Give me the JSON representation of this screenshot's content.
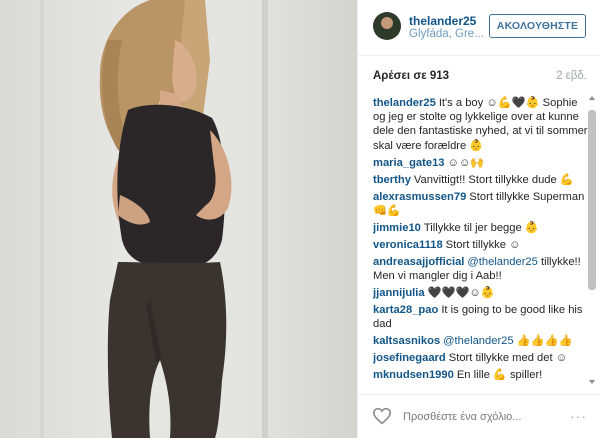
{
  "post": {
    "username": "thelander25",
    "location": "Glyfáda, Gre...",
    "follow_label": "ΑΚΟΛΟΥΘΗΣΤΕ",
    "likes": "Αρέσει σε 913",
    "time": "2 εβδ."
  },
  "comments": [
    {
      "user": "thelander25",
      "text": "It's a boy ☺💪🖤👶 Sophie og jeg er stolte og lykkelige over at kunne dele den fantastiske nyhed, at vi til sommer skal være forældre 👶"
    },
    {
      "user": "maria_gate13",
      "text": "☺☺🙌"
    },
    {
      "user": "tberthy",
      "text": "Vanvittigt!! Stort tillykke dude 💪"
    },
    {
      "user": "alexrasmussen79",
      "text": "Stort tillykke Superman 👊💪"
    },
    {
      "user": "jimmie10",
      "text": "Tillykke til jer begge 👶"
    },
    {
      "user": "veronica1118",
      "text": "Stort tillykke ☺"
    },
    {
      "user": "andreasajjofficial",
      "mention": "@thelander25",
      "text": "tillykke!! Men vi mangler dig i Aab!!"
    },
    {
      "user": "jjannijulia",
      "text": "🖤🖤🖤☺👶"
    },
    {
      "user": "karta28_pao",
      "text": "It is going to be good like his dad"
    },
    {
      "user": "kaltsasnikos",
      "mention": "@thelander25",
      "text": "👍👍👍👍"
    },
    {
      "user": "josefinegaard",
      "text": "Stort tillykke med det ☺"
    },
    {
      "user": "mknudsen1990",
      "text": "En lille 💪 spiller!"
    }
  ],
  "footer": {
    "comment_placeholder": "Προσθέστε ένα σχόλιο...",
    "more_label": "···"
  },
  "icons": {
    "like": "heart-outline-icon",
    "more": "more-options-icon"
  },
  "colors": {
    "link": "#125688",
    "follow_border": "#3f729b",
    "muted": "#a5a7aa"
  }
}
